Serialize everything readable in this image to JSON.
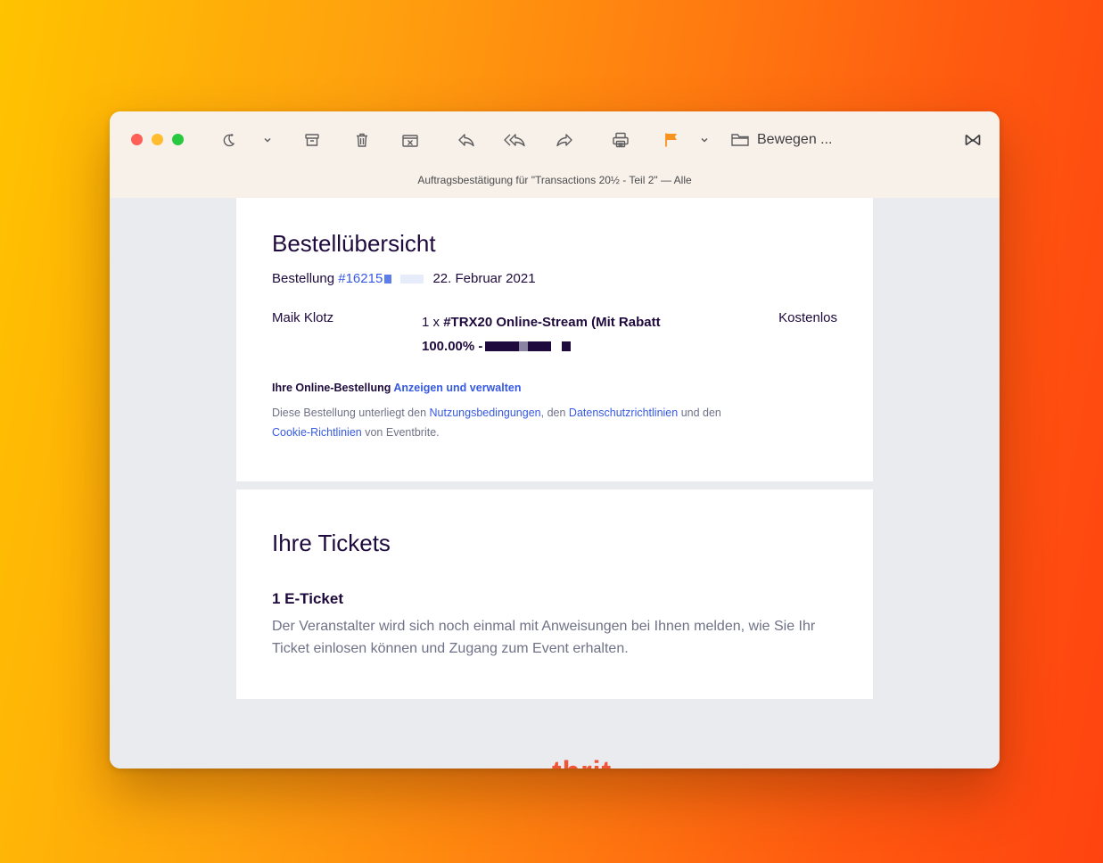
{
  "toolbar": {
    "move_label": "Bewegen ...",
    "flag_color": "#f7931e"
  },
  "subject": "Auftragsbestätigung für \"Transactions 20½ - Teil 2\" — Alle",
  "order_summary": {
    "heading": "Bestellübersicht",
    "order_label": "Bestellung",
    "order_number": "#16215",
    "order_date": "22. Februar 2021",
    "attendee": "Maik Klotz",
    "item_qty": "1 x",
    "item_name": "#TRX20 Online-Stream (Mit Rabatt 100.00% -",
    "price": "Kostenlos",
    "online_label": "Ihre Online-Bestellung",
    "manage_link": "Anzeigen und verwalten",
    "terms_1": "Diese Bestellung unterliegt den",
    "terms_link_1": "Nutzungsbedingungen",
    "terms_2": ", den",
    "terms_link_2": "Datenschutzrichtlinien",
    "terms_3": "und den",
    "terms_link_3": "Cookie-Richtlinien",
    "terms_4": "von Eventbrite."
  },
  "tickets": {
    "heading": "Ihre Tickets",
    "count_label": "1 E-Ticket",
    "note": "Der Veranstalter wird sich noch einmal mit Anweisungen bei Ihnen melden, wie Sie Ihr Ticket einlosen können und Zugang zum Event erhalten."
  },
  "footer": {
    "logo_partial": "tbrit"
  },
  "colors": {
    "link": "#3659e3",
    "text_dark": "#1e0a3c",
    "brand_orange": "#f05537"
  }
}
